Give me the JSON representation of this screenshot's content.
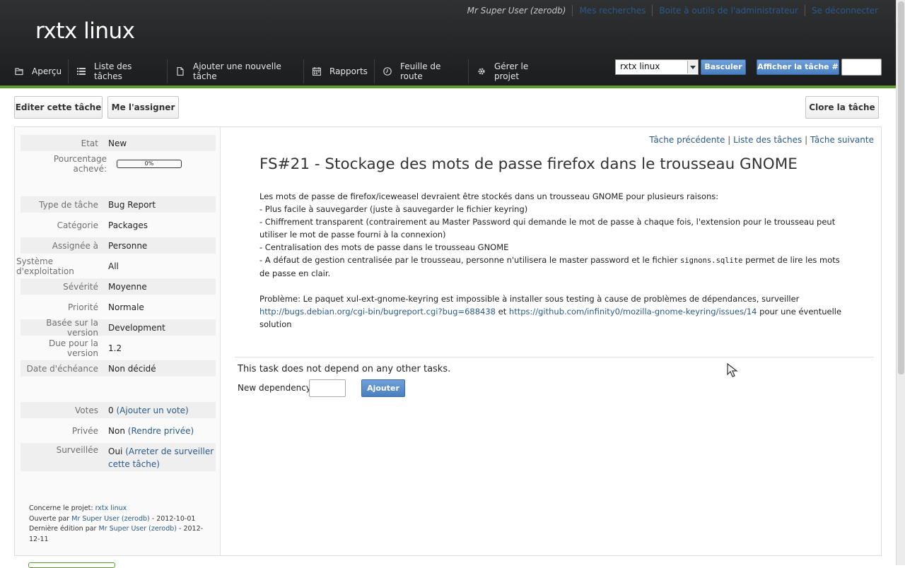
{
  "header": {
    "project_title": "rxtx linux",
    "user_menu": [
      "Mr Super User (zerodb)",
      "Mes recherches",
      "Boite à outils de l'administrateur",
      "Se déconnecter"
    ],
    "nav": [
      {
        "label": "Aperçu",
        "icon": "folder-icon"
      },
      {
        "label": "Liste des tâches",
        "icon": "list-icon"
      },
      {
        "label": "Ajouter une nouvelle tâche",
        "icon": "document-icon"
      },
      {
        "label": "Rapports",
        "icon": "calendar-icon"
      },
      {
        "label": "Feuille de route",
        "icon": "clock-icon"
      },
      {
        "label": "Gérer le projet",
        "icon": "gear-icon"
      }
    ],
    "project_select": "rxtx linux",
    "switch_label": "Basculer",
    "show_task_label": "Afficher la tâche #",
    "accent_color": "#5d9c2a"
  },
  "actions": {
    "edit_label": "Editer cette tâche",
    "assign_label": "Me l'assigner",
    "close_label": "Clore la tâche"
  },
  "fields": {
    "state": {
      "label": "Etat",
      "value": "New"
    },
    "progress": {
      "label": "Pourcentage achevé:",
      "value": "0%"
    },
    "task_type": {
      "label": "Type de tâche",
      "value": "Bug Report"
    },
    "category": {
      "label": "Catégorie",
      "value": "Packages"
    },
    "assigned": {
      "label": "Assignée à",
      "value": "Personne"
    },
    "os": {
      "label": "Système d'exploitation",
      "value": "All"
    },
    "severity": {
      "label": "Sévérité",
      "value": "Moyenne"
    },
    "priority": {
      "label": "Priorité",
      "value": "Normale"
    },
    "reported_version": {
      "label": "Basée sur la version",
      "value": "Development"
    },
    "due_version": {
      "label": "Due pour la version",
      "value": "1.2"
    },
    "due_date": {
      "label": "Date d'échéance",
      "value": "Non décidé"
    },
    "votes": {
      "label": "Votes",
      "value": "0",
      "link": "(Ajouter un vote)"
    },
    "private": {
      "label": "Privée",
      "value": "Non",
      "link": "(Rendre privée)"
    },
    "watched": {
      "label": "Surveillée",
      "value": "Oui",
      "link": "(Arreter de surveiller cette tâche)"
    }
  },
  "meta": {
    "project_prefix": "Concerne le projet:",
    "project_link": "rxtx linux",
    "opened_prefix": "Ouverte par",
    "opened_user": "Mr Super User (zerodb)",
    "opened_date": "- 2012-10-01",
    "edited_prefix": "Dernière édition par",
    "edited_user": "Mr Super User (zerodb)",
    "edited_date": "- 2012-12-11"
  },
  "task_nav": {
    "previous": "Tâche précédente",
    "list": "Liste des tâches",
    "next": "Tâche suivante",
    "separator": "|"
  },
  "task": {
    "title": "FS#21 - Stockage des mots de passe firefox dans le trousseau GNOME",
    "desc_line1": "Les mots de passe de firefox/iceweasel devraient être stockés dans un trousseau GNOME pour plusieurs raisons:",
    "desc_line2": "- Plus facile à sauvegarder (juste à sauvegarder le fichier keyring)",
    "desc_line3": "- Chiffrement transparent (contrairement au Master Password qui demande le mot de passe à chaque fois, l'extension pour le trousseau peut utiliser le mot de passe fourni à la connexion)",
    "desc_line4": "- Centralisation des mots de passe dans le trousseau GNOME",
    "desc_line5a": "- A défaut de gestion centralisée par le trousseau, personne n'utilisera le master password et le fichier",
    "desc_line5_code": "signons.sqlite",
    "desc_line5b": "permet de lire les mots de passe en clair.",
    "problem_text": "Problème: Le paquet xul-ext-gnome-keyring est impossible à installer sous testing à cause de problèmes de dépendances, surveiller",
    "link1": "http://bugs.debian.org/cgi-bin/bugreport.cgi?bug=688438",
    "and_text": "et",
    "link2": "https://github.com/infinity0/mozilla-gnome-keyring/issues/14",
    "solution_text": "pour une éventuelle solution"
  },
  "dependencies": {
    "none_text": "This task does not depend on any other tasks.",
    "new_label": "New dependency:",
    "add_label": "Ajouter"
  }
}
